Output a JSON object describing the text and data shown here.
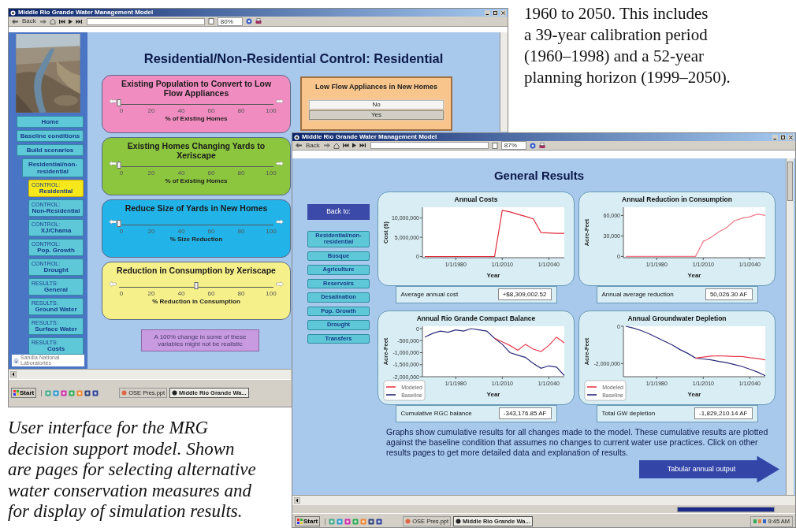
{
  "page_text": {
    "paragraph_lines": [
      "1960 to 2050. This includes",
      "a 39-year calibration period",
      "(1960–1998) and a 52-year",
      "planning horizon (1999–2050)."
    ],
    "caption_lines": [
      "User interface for the MRG",
      "decision support model. Shown",
      "are pages for selecting alternative",
      "water conservation measures and",
      "for display of simulation results."
    ]
  },
  "controls_window": {
    "title": "Middle Rio Grande Water Management Model",
    "toolbar": {
      "back": "Back",
      "zoom": "80%"
    },
    "heading": "Residential/Non-Residential Control: Residential",
    "nav": [
      {
        "label": "Home",
        "selected": false
      },
      {
        "label": "Baseline conditions",
        "selected": false
      },
      {
        "label": "Build scenarios",
        "selected": false,
        "children": [
          {
            "label": "Residential/non-residential",
            "selected": false,
            "children": [
              {
                "prefix": "CONTROL:",
                "label": "Residential",
                "selected": true
              },
              {
                "prefix": "CONTROL:",
                "label": "Non-Residential",
                "selected": false
              },
              {
                "prefix": "CONTROL:",
                "label": "XJ/Chama",
                "selected": false
              },
              {
                "prefix": "CONTROL:",
                "label": "Pop. Growth",
                "selected": false
              },
              {
                "prefix": "CONTROL:",
                "label": "Drought",
                "selected": false
              },
              {
                "prefix": "RESULTS:",
                "label": "General",
                "selected": false
              },
              {
                "prefix": "RESULTS:",
                "label": "Ground Water",
                "selected": false
              },
              {
                "prefix": "RESULTS:",
                "label": "Surface Water",
                "selected": false
              },
              {
                "prefix": "RESULTS:",
                "label": "Costs",
                "selected": false
              }
            ]
          }
        ]
      }
    ],
    "logo_text": "Sandia National Laboratories",
    "sliders": [
      {
        "title": "Existing Population to Convert to Low Flow Appliances",
        "color": "#f08cc0",
        "level": 0,
        "ticks": [
          "0",
          "20",
          "40",
          "60",
          "80",
          "100"
        ],
        "axis_label": "% of Existing Homes"
      },
      {
        "title": "Existing Homes Changing Yards to Xeriscape",
        "color": "#8cc63e",
        "level": 0,
        "ticks": [
          "0",
          "20",
          "40",
          "60",
          "80",
          "100"
        ],
        "axis_label": "% of Existing Homes"
      },
      {
        "title": "Reduce Size of Yards in New Homes",
        "color": "#22b4e8",
        "level": 0,
        "ticks": [
          "0",
          "20",
          "40",
          "60",
          "80",
          "100"
        ],
        "axis_label": "% Size Reduction"
      },
      {
        "title": "Reduction in Consumption by Xeriscape",
        "color": "#f6f08a",
        "level": 0.5,
        "ticks": [
          "0",
          "20",
          "40",
          "60",
          "80",
          "100"
        ],
        "axis_label": "% Reduction in Consumption"
      }
    ],
    "appliances": {
      "title": "Low Flow Appliances in New Homes",
      "options": [
        {
          "label": "No",
          "selected": false
        },
        {
          "label": "Yes",
          "selected": true
        }
      ]
    },
    "note": "A 100% change in some of these variables might not be realistic",
    "taskbar": {
      "start": "Start",
      "tasks": [
        {
          "label": "OSE Pres.ppt",
          "selected": false
        },
        {
          "label": "Middle Rio Grande Wa...",
          "selected": true
        }
      ]
    }
  },
  "results_window": {
    "title": "Middle Rio Grande Water Management Model",
    "toolbar": {
      "back": "Back",
      "zoom": "87%"
    },
    "heading": "General Results",
    "back_label": "Back to:",
    "nav": [
      "Residential/non-residential",
      "Bosque",
      "Agriculture",
      "Reservoirs",
      "Desalination",
      "Pop. Growth",
      "Drought",
      "Transfers"
    ],
    "charts": [
      {
        "stat_label": "Average annual cost",
        "stat_value": "+$8,309,002.52",
        "chart_data": {
          "type": "line",
          "title": "Annual Costs",
          "xlabel": "Year",
          "ylabel": "Cost ($)",
          "ylim": [
            -300000,
            12800000
          ],
          "categories": [
            null,
            null,
            null,
            null,
            "1/1/1980",
            null,
            null,
            null,
            null,
            null,
            "1/1/2010",
            null,
            null,
            null,
            null,
            null,
            "1/1/2040",
            null,
            null
          ],
          "yticks": [
            {
              "value": 0,
              "label": "0"
            },
            {
              "value": 5000000,
              "label": "5,000,000"
            },
            {
              "value": 10000000,
              "label": "10,000,000"
            }
          ],
          "series": [
            {
              "color": "#e02a3a",
              "values": [
                0,
                0,
                0,
                0,
                0,
                0,
                0,
                0,
                0,
                0,
                12000000,
                11600000,
                11000000,
                10400000,
                9800000,
                6200000,
                6100000,
                6000000,
                6000000
              ]
            }
          ]
        }
      },
      {
        "stat_label": "Annual average reduction",
        "stat_value": "50,026.30 AF",
        "chart_data": {
          "type": "line",
          "title": "Annual Reduction in Consumption",
          "xlabel": "Year",
          "ylabel": "Acre-Feet",
          "ylim": [
            -1800,
            72000
          ],
          "categories": [
            null,
            null,
            null,
            null,
            "1/1/1980",
            null,
            null,
            null,
            null,
            null,
            "1/1/2010",
            null,
            null,
            null,
            null,
            null,
            "1/1/2040",
            null,
            null
          ],
          "yticks": [
            {
              "value": 0,
              "label": "0"
            },
            {
              "value": 30000,
              "label": "30,000"
            },
            {
              "value": 60000,
              "label": "60,000"
            }
          ],
          "series": [
            {
              "color": "#f07888",
              "values": [
                0,
                0,
                0,
                0,
                0,
                0,
                0,
                0,
                0,
                0,
                22000,
                28000,
                36000,
                42000,
                52000,
                56000,
                58000,
                62000,
                60000
              ]
            }
          ]
        }
      },
      {
        "stat_label": "Cumulative RGC balance",
        "stat_value": "-343,176.85 AF",
        "chart_data": {
          "type": "line",
          "title": "Annual Rio Grande Compact Balance",
          "xlabel": "Year",
          "ylabel": "Acre-Feet",
          "ylim": [
            -2000000,
            100000
          ],
          "categories": [
            null,
            null,
            null,
            null,
            "1/1/1980",
            null,
            null,
            null,
            null,
            null,
            "1/1/2010",
            null,
            null,
            null,
            null,
            null,
            "1/1/2040",
            null,
            null
          ],
          "yticks": [
            {
              "value": 0,
              "label": "0"
            },
            {
              "value": -500000,
              "label": "-500,000"
            },
            {
              "value": -1000000,
              "label": "-1,000,000"
            },
            {
              "value": -1500000,
              "label": "-1,500,000"
            },
            {
              "value": -2000000,
              "label": "-2,000,000"
            }
          ],
          "legend": "lower left",
          "series": [
            {
              "name": "Modeled",
              "color": "#e8394a",
              "values": [
                null,
                null,
                null,
                null,
                null,
                null,
                null,
                null,
                null,
                -400000,
                -550000,
                -700000,
                -900000,
                -650000,
                -850000,
                -950000,
                -700000,
                -350000,
                -600000
              ]
            },
            {
              "name": "Baseline",
              "color": "#2a2a7a",
              "values": [
                -350000,
                -200000,
                -100000,
                -150000,
                -50000,
                -100000,
                0,
                -50000,
                -100000,
                -400000,
                -650000,
                -1000000,
                -1100000,
                -1200000,
                -1450000,
                -1650000,
                -1550000,
                -1600000,
                -1950000
              ]
            }
          ]
        }
      },
      {
        "stat_label": "Total GW depletion",
        "stat_value": "-1,829,210.14 AF",
        "chart_data": {
          "type": "line",
          "title": "Annual Groundwater Depletion",
          "xlabel": "Year",
          "ylabel": "Acre-Feet",
          "ylim": [
            -2700000,
            0
          ],
          "categories": [
            null,
            null,
            null,
            null,
            "1/1/1980",
            null,
            null,
            null,
            null,
            null,
            "1/1/2010",
            null,
            null,
            null,
            null,
            null,
            "1/1/2040",
            null,
            null
          ],
          "yticks": [
            {
              "value": 0,
              "label": "0"
            },
            {
              "value": -2000000,
              "label": "-2,000,000"
            }
          ],
          "legend": "lower left",
          "series": [
            {
              "name": "Modeled",
              "color": "#e8394a",
              "values": [
                null,
                null,
                null,
                null,
                null,
                null,
                null,
                null,
                null,
                -1700000,
                -1650000,
                -1600000,
                -1580000,
                -1600000,
                -1620000,
                -1620000,
                -1680000,
                -1720000,
                -1800000
              ]
            },
            {
              "name": "Baseline",
              "color": "#2a2a7a",
              "values": [
                0,
                -100000,
                -230000,
                -400000,
                -600000,
                -800000,
                -1000000,
                -1250000,
                -1450000,
                -1700000,
                -1750000,
                -1800000,
                -1880000,
                -1950000,
                -2050000,
                -2150000,
                -2300000,
                -2450000,
                -2650000
              ]
            }
          ]
        }
      }
    ],
    "description": "Graphs show cumulative results for all changes made to the model. These cumulative results are plotted against the baseline condition that assumes no changes to current water use practices. Click on other results pages to get more detailed data and explanation of results.",
    "output_button": "Tabular annual output",
    "status_progress": {
      "level": 1
    },
    "taskbar": {
      "start": "Start",
      "tasks": [
        {
          "label": "OSE Pres.ppt",
          "selected": false
        },
        {
          "label": "Middle Rio Grande Wa...",
          "selected": true
        }
      ],
      "clock": "9:45 AM"
    }
  }
}
